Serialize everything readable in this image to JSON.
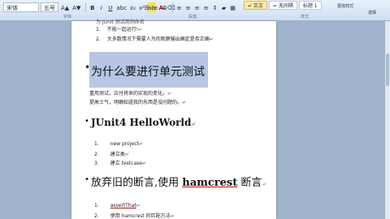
{
  "ribbon": {
    "font_name": "宋体",
    "font_size": "五号",
    "bold": "B",
    "italic": "I",
    "underline": "U",
    "text_highlight": "ab",
    "font_color": "A",
    "group_labels": [
      "字体",
      "段落",
      "样式"
    ],
    "styles": [
      "↵ 正文",
      "↵ 无间隔",
      "标题 1"
    ],
    "change_styles": "更改样式",
    "select": "选择"
  },
  "document": {
    "top_cut_text": "为 JUnit 测试用例命名",
    "items": [
      {
        "num": "1.",
        "text": "不能一起运行!"
      },
      {
        "num": "2.",
        "text": "大多数情况下需要人为的观察输出确定是否正确"
      }
    ],
    "heading1": "为什么要进行单元测试",
    "para1": "重用测试，应付将来的实现的变化。",
    "para2": "提高士气，明确知道我的东西是没问题的。",
    "heading2": "JUnit4 HelloWorld",
    "list2": [
      {
        "num": "1.",
        "text": "new project"
      },
      {
        "num": "2.",
        "text": "建立类"
      },
      {
        "num": "3.",
        "text": "建立 testcase"
      }
    ],
    "heading3_pre": "放弃旧的断言,使用 ",
    "heading3_word": "hamcrest",
    "heading3_post": " 断言",
    "list3": [
      {
        "num": "1.",
        "text": "assertThat"
      },
      {
        "num": "2.",
        "text": "使用 hamcrest 的匹配方法"
      }
    ],
    "para_mark": "↵"
  },
  "colors": {
    "ribbon_bg": "#dce8f6",
    "canvas_bg": "#9fb3cc",
    "selection": "#b7c6e4"
  }
}
